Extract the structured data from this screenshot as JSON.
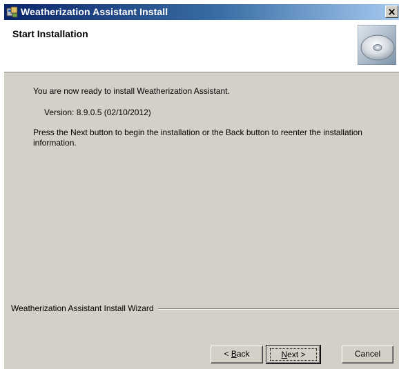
{
  "window": {
    "title": "Weatherization Assistant Install",
    "close_glyph": "×",
    "icon": "installer-icon"
  },
  "header": {
    "title": "Start Installation",
    "icon": "cd-icon"
  },
  "content": {
    "ready_text": "You are now ready to install Weatherization Assistant.",
    "version_text": "Version: 8.9.0.5 (02/10/2012)",
    "instruction_text": "Press the Next button to begin the installation or the Back button to reenter the installation information."
  },
  "wizard": {
    "label": "Weatherization Assistant Install Wizard"
  },
  "buttons": {
    "back": {
      "prefix": "< ",
      "mnemonic": "B",
      "rest": "ack"
    },
    "next": {
      "mnemonic": "N",
      "rest": "ext >"
    },
    "cancel": "Cancel"
  },
  "colors": {
    "dialog_face": "#d4d0c8",
    "title_start": "#0a246a",
    "title_end": "#a6caf0",
    "header_bg": "#ffffff"
  }
}
